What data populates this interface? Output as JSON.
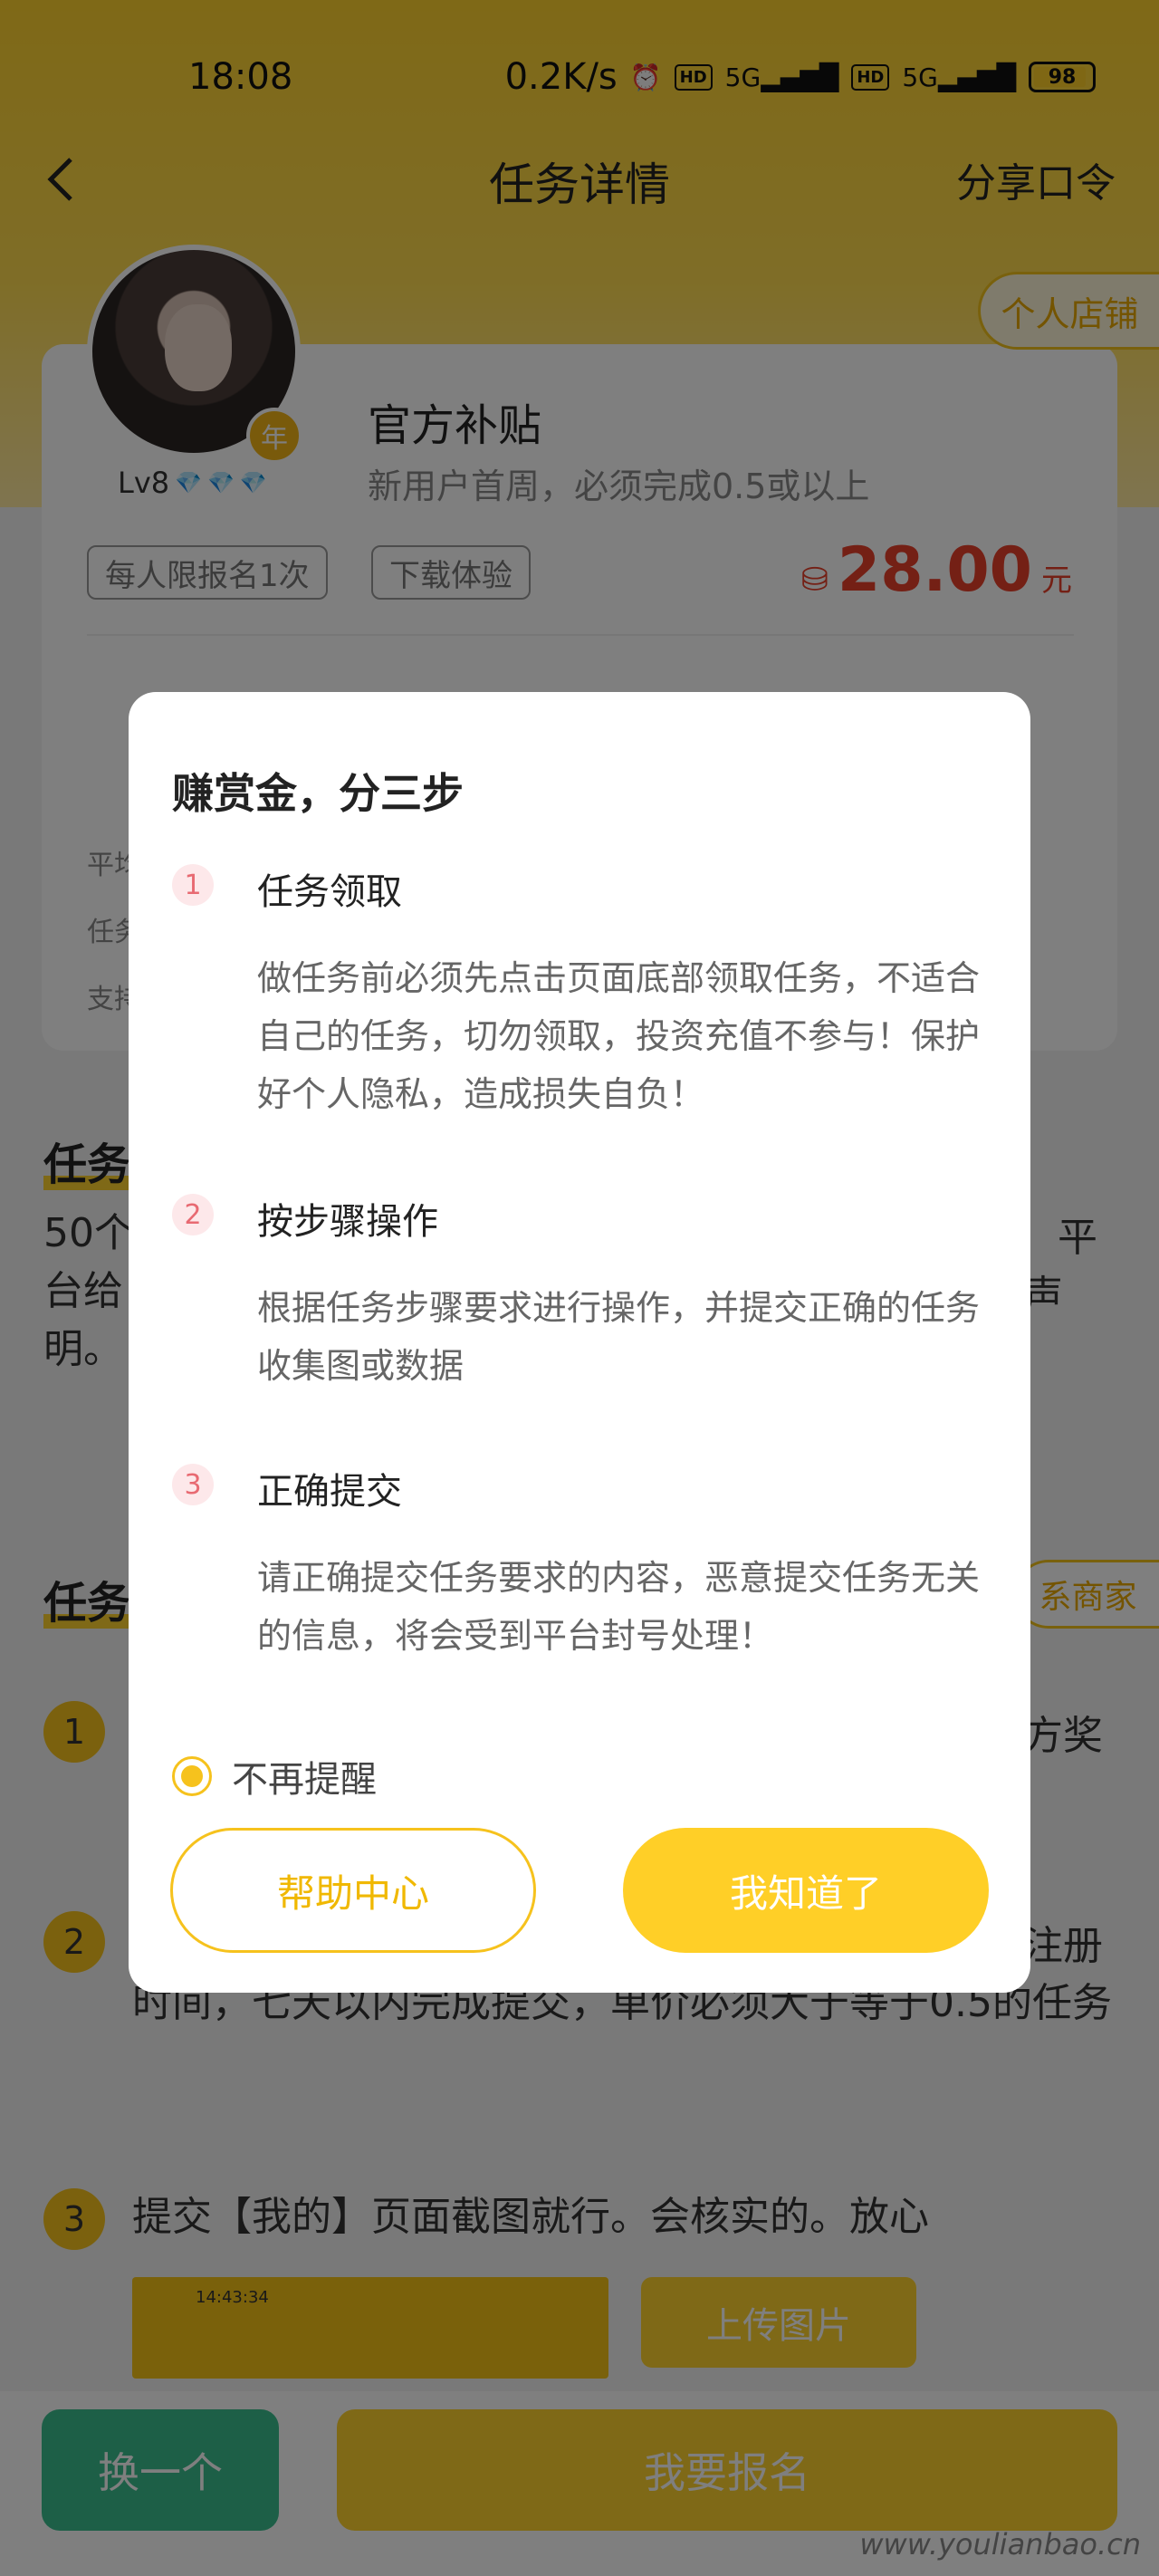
{
  "status_bar": {
    "time": "18:08",
    "network_speed": "0.2K/s",
    "alarm_icon": "alarm-icon",
    "hd_label": "HD",
    "signal_label": "5G",
    "battery_level": "98"
  },
  "nav": {
    "title": "任务详情",
    "share_label": "分享口令",
    "back_icon": "back-arrow-icon"
  },
  "shop_tag": "个人店铺",
  "profile": {
    "year_badge": "年",
    "level": "Lv8",
    "gems": [
      "💎",
      "💎",
      "💎"
    ]
  },
  "task": {
    "name": "官方补贴",
    "subtitle": "新用户首周，必须完成0.5或以上",
    "tags": [
      "每人限报名1次",
      "下载体验"
    ],
    "price": "28.00",
    "price_unit": "元",
    "info_lines": [
      "平均",
      "任务",
      "支持"
    ]
  },
  "description": {
    "title": "任务",
    "text_lines": [
      "50个",
      "台给",
      "明。"
    ],
    "right_fragments": [
      "平",
      "声"
    ]
  },
  "steps": {
    "title": "任务",
    "contact_label": "系商家",
    "items": [
      {
        "num": "1",
        "text": "",
        "tail": "方奖"
      },
      {
        "num": "2",
        "text": "时间，七天以内完成提交，单价必须大于等于0.5的任务",
        "tail": "注册"
      },
      {
        "num": "3",
        "text": "提交【我的】页面截图就行。会核实的。放心",
        "tail": ""
      }
    ],
    "thumb_time": "14:43:34",
    "upload_label": "上传图片"
  },
  "bottom": {
    "change_label": "换一个",
    "signup_label": "我要报名"
  },
  "watermark": "www.youlianbao.cn",
  "modal": {
    "title": "赚赏金，分三步",
    "steps": [
      {
        "num": "1",
        "head": "任务领取",
        "body": "做任务前必须先点击页面底部领取任务，不适合自己的任务，切勿领取，投资充值不参与！保护好个人隐私，造成损失自负！"
      },
      {
        "num": "2",
        "head": "按步骤操作",
        "body": "根据任务步骤要求进行操作，并提交正确的任务收集图或数据"
      },
      {
        "num": "3",
        "head": "正确提交",
        "body": "请正确提交任务要求的内容，恶意提交任务无关的信息，将会受到平台封号处理！"
      }
    ],
    "dont_remind": "不再提醒",
    "help_label": "帮助中心",
    "ok_label": "我知道了"
  }
}
